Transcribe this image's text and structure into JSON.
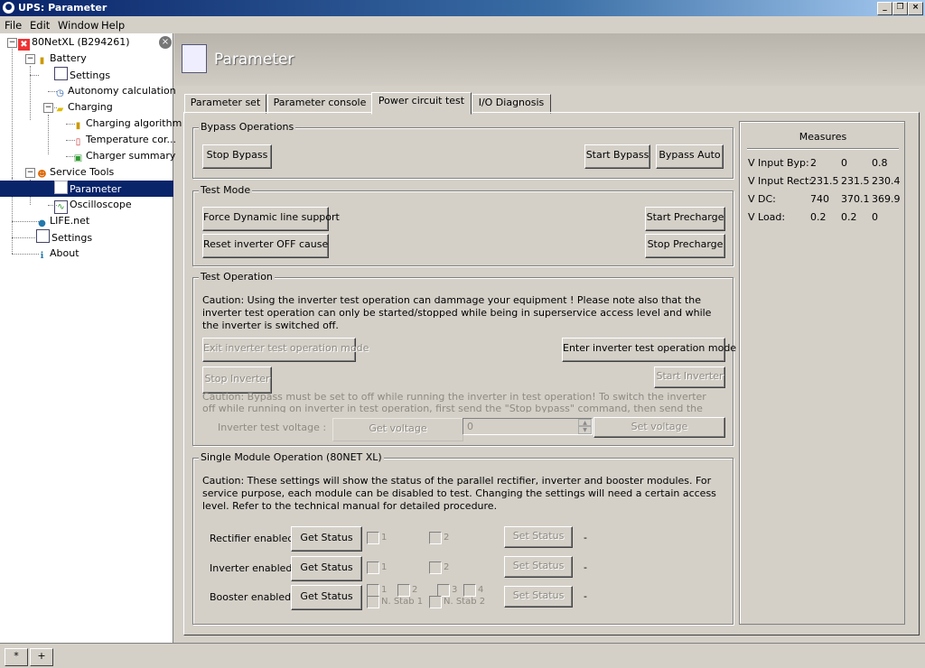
{
  "window": {
    "title": "UPS: Parameter"
  },
  "menu": [
    "File",
    "Edit",
    "Window",
    "Help"
  ],
  "tree": {
    "root": "80NetXL (B294261)",
    "battery": "Battery",
    "settings": "Settings",
    "autonomy": "Autonomy calculation",
    "charging": "Charging",
    "charging_algorithm": "Charging algorithm",
    "temperature": "Temperature cor...",
    "charger_summary": "Charger summary",
    "service_tools": "Service Tools",
    "parameter": "Parameter",
    "oscilloscope": "Oscilloscope",
    "lifenet": "LIFE.net",
    "settings2": "Settings",
    "about": "About"
  },
  "header": {
    "title": "Parameter"
  },
  "tabs": [
    "Parameter set",
    "Parameter console",
    "Power circuit test",
    "I/O Diagnosis"
  ],
  "bypass": {
    "title": "Bypass Operations",
    "stop": "Stop Bypass",
    "start": "Start Bypass",
    "auto": "Bypass Auto"
  },
  "testmode": {
    "title": "Test Mode",
    "force": "Force Dynamic line support",
    "reset": "Reset inverter OFF cause",
    "start_precharge": "Start Precharge",
    "stop_precharge": "Stop Precharge"
  },
  "testop": {
    "title": "Test Operation",
    "caution1": "Caution: Using the inverter test operation can dammage your equipment ! Please note also that the inverter test operation can only be started/stopped while being in superservice access level and while the inverter is switched off.",
    "exit": "Exit inverter test operation mode",
    "enter": "Enter inverter test operation mode",
    "stop_inverter": "Stop Inverter",
    "start_inverter": "Start Inverter",
    "caution2": "Caution: Bypass must be set to off while running the inverter in test operation! To switch the inverter off while running on inverter in test operation, first send the \"Stop bypass\" command, then send the \"Stop Inverter\" command. Don't",
    "voltage_label": "Inverter test voltage :",
    "get_voltage": "Get voltage",
    "voltage_value": "0",
    "set_voltage": "Set voltage"
  },
  "single": {
    "title": "Single Module Operation (80NET XL)",
    "caution": "Caution: These settings will show the status of the parallel rectifier, inverter and booster modules. For service purpose, each module can be disabled to test. Changing the settings will need a certain access level. Refer to the technical manual for detailed procedure.",
    "rectifier_label": "Rectifier enabled:",
    "inverter_label": "Inverter enabled:",
    "booster_label": "Booster enabled:",
    "get_status": "Get Status",
    "set_status": "Set Status",
    "dash": "-",
    "c1": "1",
    "c2": "2",
    "c3": "3",
    "c4": "4",
    "nstab1": "N. Stab 1",
    "nstab2": "N. Stab 2"
  },
  "measures": {
    "title": "Measures",
    "rows": [
      {
        "label": "V Input Byp:",
        "v1": "2",
        "v2": "0",
        "v3": "0.8"
      },
      {
        "label": "V Input Rect:",
        "v1": "231.5",
        "v2": "231.5",
        "v3": "230.4"
      },
      {
        "label": "V DC:",
        "v1": "740",
        "v2": "370.1",
        "v3": "369.9"
      },
      {
        "label": "V Load:",
        "v1": "0.2",
        "v2": "0.2",
        "v3": "0"
      }
    ]
  },
  "bottom": {
    "star": "*",
    "plus": "+"
  }
}
